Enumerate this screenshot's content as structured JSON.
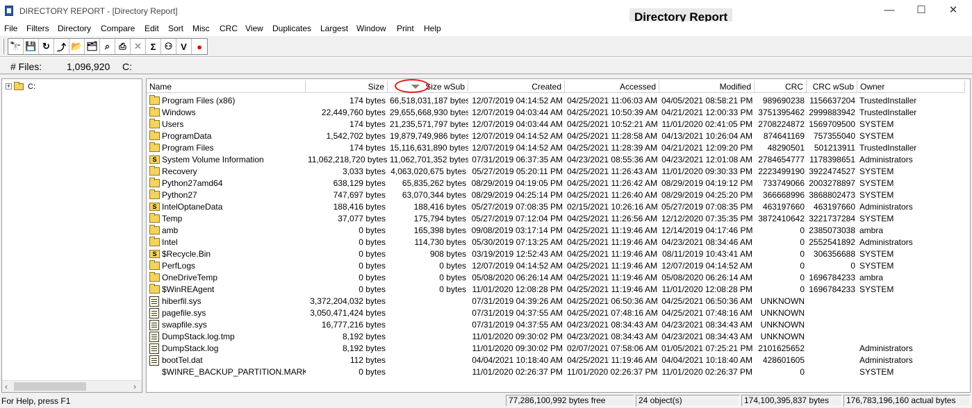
{
  "window": {
    "title": "DIRECTORY REPORT - [Directory Report]",
    "overlay_title": "Directory Report",
    "controls": [
      "—",
      "☐",
      "✕"
    ]
  },
  "menu": [
    "File",
    "Filters",
    "Directory",
    "Compare",
    "Edit",
    "Sort",
    "Misc",
    "CRC",
    "View",
    "Duplicates",
    "Largest",
    "Window",
    "Print",
    "Help"
  ],
  "toolbar": {
    "buttons": [
      {
        "name": "find-icon",
        "glyph": "🔭"
      },
      {
        "name": "save-icon",
        "glyph": "💾"
      },
      {
        "name": "refresh-icon",
        "glyph": "↻"
      },
      {
        "name": "up-folder-icon",
        "glyph": "⤴"
      },
      {
        "name": "open-folder-icon",
        "glyph": "📂"
      },
      {
        "name": "browse-folder-icon",
        "glyph": "🗂"
      },
      {
        "name": "search-icon",
        "glyph": "⌕"
      },
      {
        "name": "print-icon",
        "glyph": "⎙"
      },
      {
        "name": "cancel-icon",
        "glyph": "✕"
      },
      {
        "name": "sum-icon",
        "glyph": "Σ"
      },
      {
        "name": "duplicates-icon",
        "glyph": "⚇"
      },
      {
        "name": "verify-icon",
        "glyph": "V"
      },
      {
        "name": "stop-icon",
        "glyph": "●"
      }
    ]
  },
  "files_bar": {
    "label": "# Files:",
    "count": "1,096,920",
    "path": "C:"
  },
  "tree": {
    "root_label": "C:",
    "expander": "+"
  },
  "columns": [
    "Name",
    "Size",
    "Size wSub",
    "Created",
    "Accessed",
    "Modified",
    "CRC",
    "CRC wSub",
    "Owner"
  ],
  "rows": [
    {
      "icon": "folder",
      "name": "Program Files (x86)",
      "size": "174 bytes",
      "size_wsub": "66,518,031,187 bytes",
      "created": "12/07/2019 04:14:52 AM",
      "accessed": "04/25/2021 11:06:03 AM",
      "modified": "04/05/2021 08:58:21 PM",
      "crc": "989690238",
      "crc_wsub": "1156637204",
      "owner": "TrustedInstaller"
    },
    {
      "icon": "folder",
      "name": "Windows",
      "size": "22,449,760 bytes",
      "size_wsub": "29,655,668,930 bytes",
      "created": "12/07/2019 04:03:44 AM",
      "accessed": "04/25/2021 10:50:39 AM",
      "modified": "04/21/2021 12:00:33 PM",
      "crc": "3751395462",
      "crc_wsub": "2999883942",
      "owner": "TrustedInstaller"
    },
    {
      "icon": "folder",
      "name": "Users",
      "size": "174 bytes",
      "size_wsub": "21,235,571,797 bytes",
      "created": "12/07/2019 04:03:44 AM",
      "accessed": "04/25/2021 10:52:21 AM",
      "modified": "11/01/2020 02:41:05 PM",
      "crc": "2708224872",
      "crc_wsub": "1569709500",
      "owner": "SYSTEM"
    },
    {
      "icon": "folder",
      "name": "ProgramData",
      "size": "1,542,702 bytes",
      "size_wsub": "19,879,749,986 bytes",
      "created": "12/07/2019 04:14:52 AM",
      "accessed": "04/25/2021 11:28:58 AM",
      "modified": "04/13/2021 10:26:04 AM",
      "crc": "874641169",
      "crc_wsub": "757355040",
      "owner": "SYSTEM"
    },
    {
      "icon": "folder",
      "name": "Program Files",
      "size": "174 bytes",
      "size_wsub": "15,116,631,890 bytes",
      "created": "12/07/2019 04:14:52 AM",
      "accessed": "04/25/2021 11:28:39 AM",
      "modified": "04/21/2021 12:09:20 PM",
      "crc": "48290501",
      "crc_wsub": "501213911",
      "owner": "TrustedInstaller"
    },
    {
      "icon": "sys-folder",
      "name": "System Volume Information",
      "size": "11,062,218,720 bytes",
      "size_wsub": "11,062,701,352 bytes",
      "created": "07/31/2019 06:37:35 AM",
      "accessed": "04/23/2021 08:55:36 AM",
      "modified": "04/23/2021 12:01:08 AM",
      "crc": "2784654777",
      "crc_wsub": "1178398651",
      "owner": "Administrators"
    },
    {
      "icon": "folder",
      "name": "Recovery",
      "size": "3,033 bytes",
      "size_wsub": "4,063,020,675 bytes",
      "created": "05/27/2019 05:20:11 PM",
      "accessed": "04/25/2021 11:26:43 AM",
      "modified": "11/01/2020 09:30:33 PM",
      "crc": "2223499190",
      "crc_wsub": "3922474527",
      "owner": "SYSTEM"
    },
    {
      "icon": "folder",
      "name": "Python27amd64",
      "size": "638,129 bytes",
      "size_wsub": "65,835,262 bytes",
      "created": "08/29/2019 04:19:05 PM",
      "accessed": "04/25/2021 11:26:42 AM",
      "modified": "08/29/2019 04:19:12 PM",
      "crc": "733749066",
      "crc_wsub": "2003278897",
      "owner": "SYSTEM"
    },
    {
      "icon": "folder",
      "name": "Python27",
      "size": "747,697 bytes",
      "size_wsub": "63,070,344 bytes",
      "created": "08/29/2019 04:25:14 PM",
      "accessed": "04/25/2021 11:26:40 AM",
      "modified": "08/29/2019 04:25:20 PM",
      "crc": "366668996",
      "crc_wsub": "3868802473",
      "owner": "SYSTEM"
    },
    {
      "icon": "sys-folder",
      "name": "IntelOptaneData",
      "size": "188,416 bytes",
      "size_wsub": "188,416 bytes",
      "created": "05/27/2019 07:08:35 PM",
      "accessed": "02/15/2021 10:26:16 AM",
      "modified": "05/27/2019 07:08:35 PM",
      "crc": "463197660",
      "crc_wsub": "463197660",
      "owner": "Administrators"
    },
    {
      "icon": "folder",
      "name": "Temp",
      "size": "37,077 bytes",
      "size_wsub": "175,794 bytes",
      "created": "05/27/2019 07:12:04 PM",
      "accessed": "04/25/2021 11:26:56 AM",
      "modified": "12/12/2020 07:35:35 PM",
      "crc": "3872410642",
      "crc_wsub": "3221737284",
      "owner": "SYSTEM"
    },
    {
      "icon": "folder",
      "name": "amb",
      "size": "0 bytes",
      "size_wsub": "165,398 bytes",
      "created": "09/08/2019 03:17:14 PM",
      "accessed": "04/25/2021 11:19:46 AM",
      "modified": "12/14/2019 04:17:46 PM",
      "crc": "0",
      "crc_wsub": "2385073038",
      "owner": "ambra"
    },
    {
      "icon": "folder",
      "name": "Intel",
      "size": "0 bytes",
      "size_wsub": "114,730 bytes",
      "created": "05/30/2019 07:13:25 AM",
      "accessed": "04/25/2021 11:19:46 AM",
      "modified": "04/23/2021 08:34:46 AM",
      "crc": "0",
      "crc_wsub": "2552541892",
      "owner": "Administrators"
    },
    {
      "icon": "sys-folder",
      "name": "$Recycle.Bin",
      "size": "0 bytes",
      "size_wsub": "908 bytes",
      "created": "03/19/2019 12:52:43 AM",
      "accessed": "04/25/2021 11:19:46 AM",
      "modified": "08/11/2019 10:43:41 AM",
      "crc": "0",
      "crc_wsub": "306356688",
      "owner": "SYSTEM"
    },
    {
      "icon": "folder",
      "name": "PerfLogs",
      "size": "0 bytes",
      "size_wsub": "0 bytes",
      "created": "12/07/2019 04:14:52 AM",
      "accessed": "04/25/2021 11:19:46 AM",
      "modified": "12/07/2019 04:14:52 AM",
      "crc": "0",
      "crc_wsub": "0",
      "owner": "SYSTEM"
    },
    {
      "icon": "folder",
      "name": "OneDriveTemp",
      "size": "0 bytes",
      "size_wsub": "0 bytes",
      "created": "05/08/2020 06:26:14 AM",
      "accessed": "04/25/2021 11:19:46 AM",
      "modified": "05/08/2020 06:26:14 AM",
      "crc": "0",
      "crc_wsub": "1696784233",
      "owner": "ambra"
    },
    {
      "icon": "folder",
      "name": "$WinREAgent",
      "size": "0 bytes",
      "size_wsub": "0 bytes",
      "created": "11/01/2020 12:08:28 PM",
      "accessed": "04/25/2021 11:19:46 AM",
      "modified": "11/01/2020 12:08:28 PM",
      "crc": "0",
      "crc_wsub": "1696784233",
      "owner": "SYSTEM"
    },
    {
      "icon": "file",
      "name": "hiberfil.sys",
      "size": "3,372,204,032 bytes",
      "size_wsub": "",
      "created": "07/31/2019 04:39:26 AM",
      "accessed": "04/25/2021 06:50:36 AM",
      "modified": "04/25/2021 06:50:36 AM",
      "crc": "UNKNOWN",
      "crc_wsub": "",
      "owner": ""
    },
    {
      "icon": "file",
      "name": "pagefile.sys",
      "size": "3,050,471,424 bytes",
      "size_wsub": "",
      "created": "07/31/2019 04:37:55 AM",
      "accessed": "04/25/2021 07:48:16 AM",
      "modified": "04/25/2021 07:48:16 AM",
      "crc": "UNKNOWN",
      "crc_wsub": "",
      "owner": ""
    },
    {
      "icon": "file",
      "name": "swapfile.sys",
      "size": "16,777,216 bytes",
      "size_wsub": "",
      "created": "07/31/2019 04:37:55 AM",
      "accessed": "04/23/2021 08:34:43 AM",
      "modified": "04/23/2021 08:34:43 AM",
      "crc": "UNKNOWN",
      "crc_wsub": "",
      "owner": ""
    },
    {
      "icon": "file",
      "name": "DumpStack.log.tmp",
      "size": "8,192 bytes",
      "size_wsub": "",
      "created": "11/01/2020 09:30:02 PM",
      "accessed": "04/23/2021 08:34:43 AM",
      "modified": "04/23/2021 08:34:43 AM",
      "crc": "UNKNOWN",
      "crc_wsub": "",
      "owner": ""
    },
    {
      "icon": "file",
      "name": "DumpStack.log",
      "size": "8,192 bytes",
      "size_wsub": "",
      "created": "11/01/2020 09:30:02 PM",
      "accessed": "02/07/2021 07:58:06 AM",
      "modified": "01/05/2021 07:25:21 PM",
      "crc": "2101625652",
      "crc_wsub": "",
      "owner": "Administrators"
    },
    {
      "icon": "file",
      "name": "bootTel.dat",
      "size": "112 bytes",
      "size_wsub": "",
      "created": "04/04/2021 10:18:40 AM",
      "accessed": "04/25/2021 11:19:46 AM",
      "modified": "04/04/2021 10:18:40 AM",
      "crc": "428601605",
      "crc_wsub": "",
      "owner": "Administrators"
    },
    {
      "icon": "none",
      "name": "$WINRE_BACKUP_PARTITION.MARKER",
      "size": "0 bytes",
      "size_wsub": "",
      "created": "11/01/2020 02:26:37 PM",
      "accessed": "11/01/2020 02:26:37 PM",
      "modified": "11/01/2020 02:26:37 PM",
      "crc": "0",
      "crc_wsub": "",
      "owner": "SYSTEM"
    }
  ],
  "status": {
    "help": "For Help, press F1",
    "free": "77,286,100,992 bytes free",
    "objects": "24 object(s)",
    "bytes": "174,100,395,837 bytes",
    "actual": "176,783,196,160 actual bytes"
  },
  "colors": {
    "folder": "#f4d35e",
    "sort_marker": "#e0201e",
    "stop": "#e00000"
  }
}
